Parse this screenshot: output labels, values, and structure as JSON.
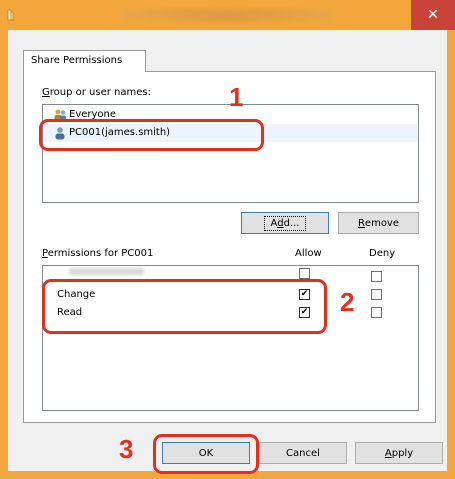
{
  "window": {
    "close_glyph": "✕",
    "accent": "#f3a63b",
    "close_color": "#c8443a"
  },
  "tab": {
    "label": "Share Permissions"
  },
  "groups": {
    "label_mnemonic": "G",
    "label_rest": "roup or user names:",
    "items": [
      {
        "name": "Everyone",
        "icon": "group-icon"
      },
      {
        "name": "PC001(james.smith)",
        "icon": "user-icon",
        "selected": true
      }
    ],
    "add_mnemonic": "d",
    "add_pre": "A",
    "add_post": "d...",
    "remove_mnemonic": "R",
    "remove_rest": "emove"
  },
  "permissions": {
    "label_mnemonic": "P",
    "label_rest": "ermissions for PC001",
    "allow_header": "Allow",
    "deny_header": "Deny",
    "rows": [
      {
        "name": "Full Control",
        "allow": false,
        "deny": false,
        "obscured": true
      },
      {
        "name": "Change",
        "allow": true,
        "deny": false
      },
      {
        "name": "Read",
        "allow": true,
        "deny": false
      }
    ],
    "check_glyph": "✔"
  },
  "buttons": {
    "ok": "OK",
    "cancel": "Cancel",
    "apply_mnemonic": "A",
    "apply_rest": "pply"
  },
  "callouts": {
    "one": "1",
    "two": "2",
    "three": "3",
    "color": "#e0301e"
  }
}
